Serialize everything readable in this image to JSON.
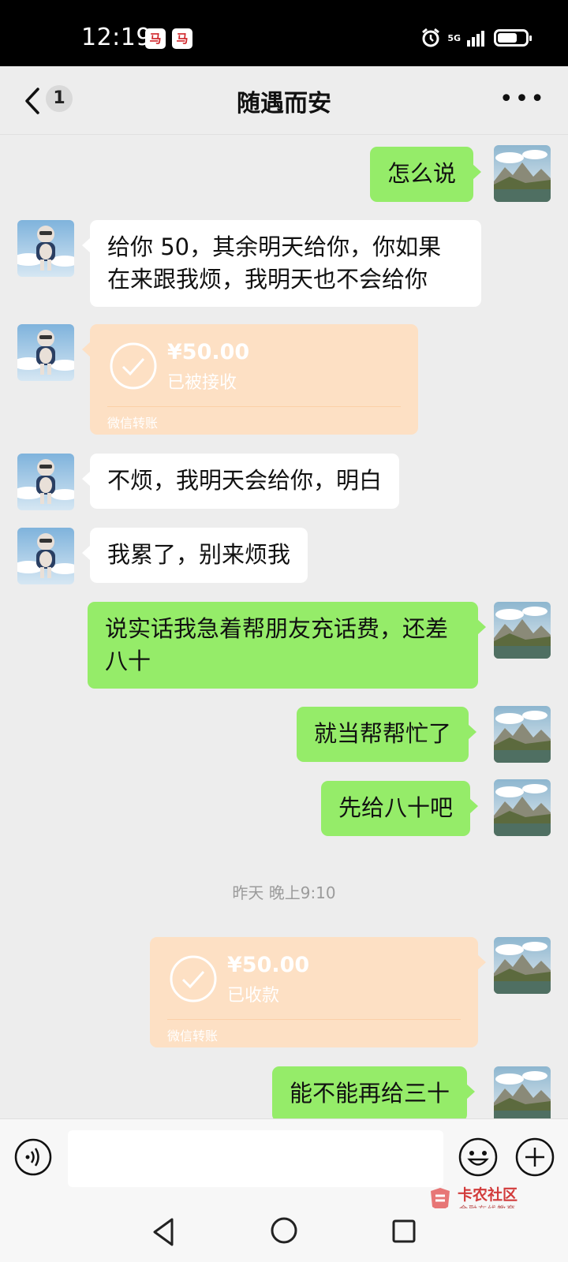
{
  "status_bar": {
    "time": "12:19",
    "notif_glyph": "ⓘ",
    "network": "5G"
  },
  "header": {
    "back_icon": "chevron-left-icon",
    "unread_count": "1",
    "title": "随遇而安",
    "more_icon": "more-dots-icon"
  },
  "messages": {
    "m1": "怎么说",
    "m2": "给你 50，其余明天给你，你如果在来跟我烦，我明天也不会给你",
    "m3": {
      "amount": "¥50.00",
      "status": "已被接收",
      "label": "微信转账"
    },
    "m4": "不烦，我明天会给你，明白",
    "m5": "我累了，别来烦我",
    "m6": "说实话我急着帮朋友充话费，还差八十",
    "m7": "就当帮帮忙了",
    "m8": "先给八十吧",
    "timestamp": "昨天 晚上9:10",
    "m9": {
      "amount": "¥50.00",
      "status": "已收款",
      "label": "微信转账"
    },
    "m10": "能不能再给三十"
  },
  "input_bar": {
    "voice_icon": "voice-icon",
    "emoji_icon": "emoji-icon",
    "plus_icon": "plus-icon"
  },
  "watermark": {
    "name": "卡农社区",
    "sub": "金融在线教育"
  },
  "colors": {
    "green_bubble": "#95ec69",
    "transfer": "#fde0c4",
    "background": "#ededed"
  }
}
